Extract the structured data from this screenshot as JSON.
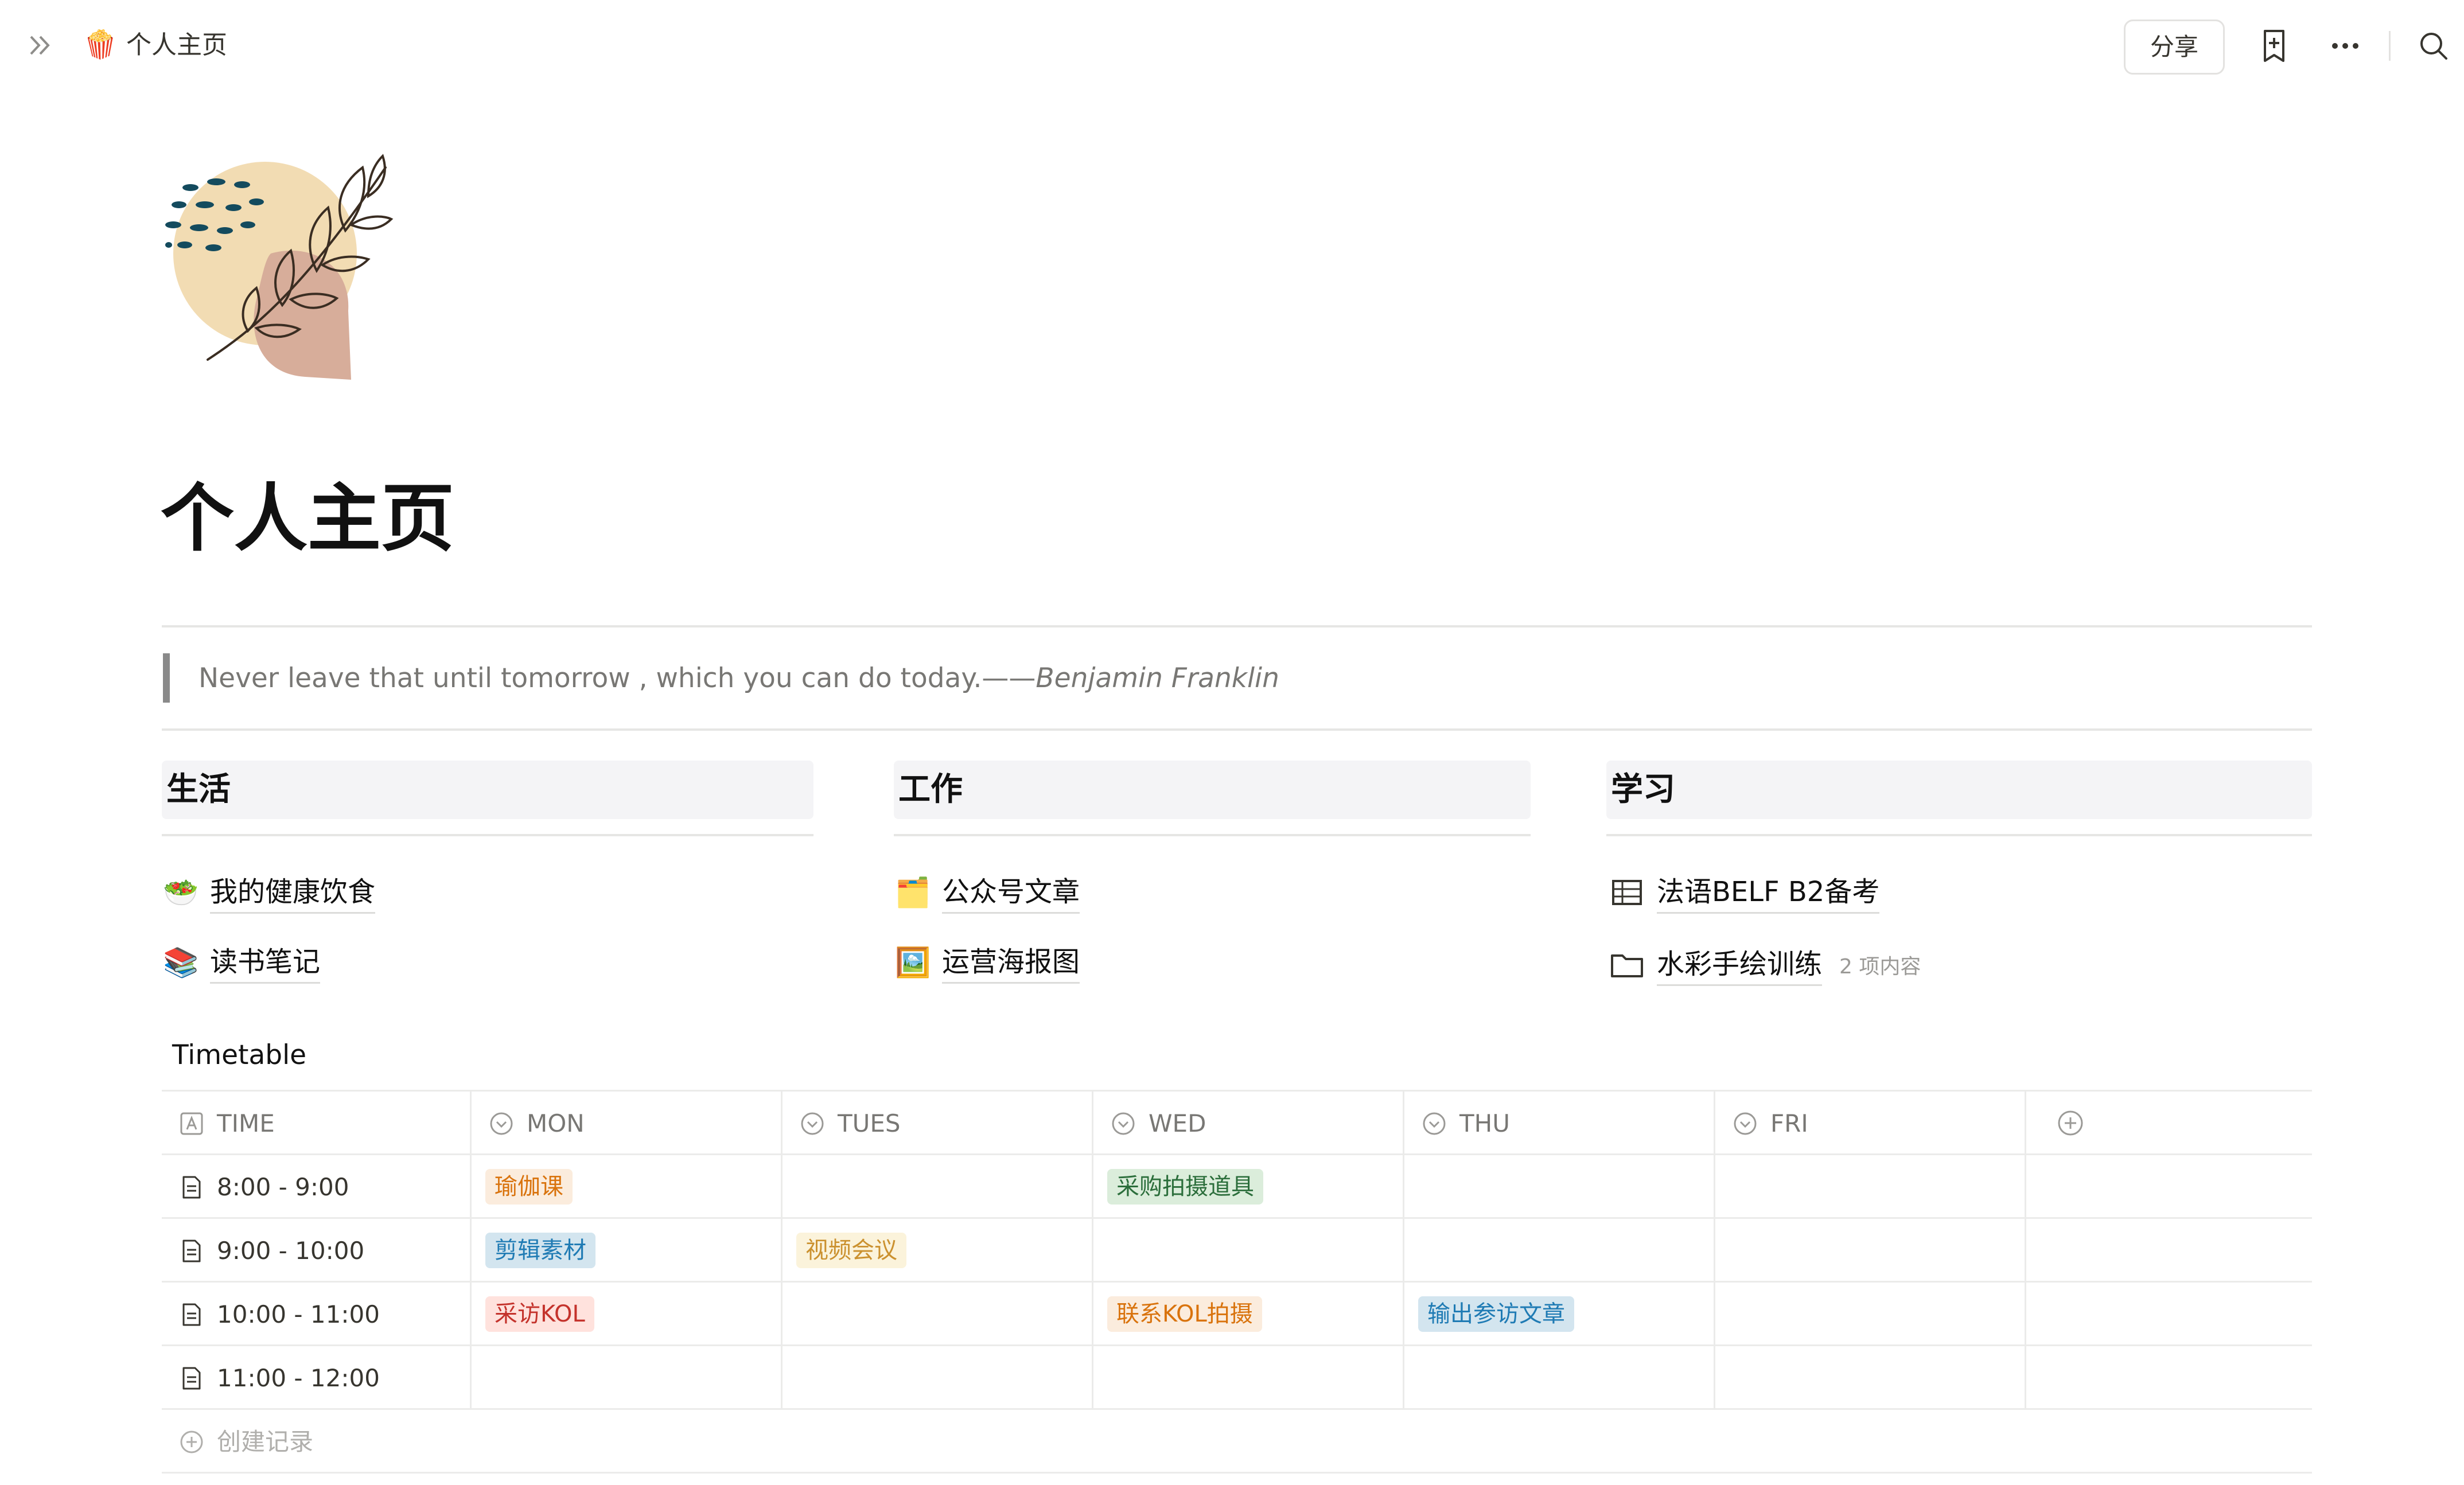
{
  "topbar": {
    "breadcrumb_emoji": "🍿",
    "breadcrumb_title": "个人主页",
    "share_label": "分享",
    "icons": [
      "sidebar-expand-icon",
      "add-page-icon",
      "more-icon",
      "search-icon"
    ]
  },
  "page": {
    "title": "个人主页",
    "quote_text": "Never leave that until tomorrow , which you can do today.——",
    "quote_author": "Benjamin Franklin"
  },
  "columns": [
    {
      "heading": "生活",
      "items": [
        {
          "emoji": "🥗",
          "label": "我的健康饮食"
        },
        {
          "emoji": "📚",
          "label": "读书笔记"
        }
      ]
    },
    {
      "heading": "工作",
      "items": [
        {
          "emoji": "🗂️",
          "label": "公众号文章"
        },
        {
          "emoji": "🖼️",
          "label": "运营海报图"
        }
      ]
    },
    {
      "heading": "学习",
      "items": [
        {
          "icon": "table-icon",
          "label": "法语BELF B2备考"
        },
        {
          "icon": "folder-icon",
          "label": "水彩手绘训练",
          "count": "2 项内容"
        }
      ]
    }
  ],
  "timetable": {
    "title": "Timetable",
    "headers": [
      "TIME",
      "MON",
      "TUES",
      "WED",
      "THU",
      "FRI"
    ],
    "rows": [
      {
        "time": "8:00 - 9:00",
        "mon": "瑜伽课",
        "tues": "",
        "wed": "采购拍摄道具",
        "thu": "",
        "fri": ""
      },
      {
        "time": "9:00 - 10:00",
        "mon": "剪辑素材",
        "tues": "视频会议",
        "wed": "",
        "thu": "",
        "fri": ""
      },
      {
        "time": "10:00 - 11:00",
        "mon": "采访KOL",
        "tues": "",
        "wed": "联系KOL拍摄",
        "thu": "输出参访文章",
        "fri": ""
      },
      {
        "time": "11:00 - 12:00",
        "mon": "",
        "tues": "",
        "wed": "",
        "thu": "",
        "fri": ""
      }
    ],
    "new_row_label": "创建记录"
  },
  "tag_colors": {
    "orange": {
      "bg": "#fbecdd",
      "fg": "#d9730d"
    },
    "green": {
      "bg": "#dbeddb",
      "fg": "#2b6e3b"
    },
    "blue": {
      "bg": "#d3e5ef",
      "fg": "#1f7bb4"
    },
    "yellow": {
      "bg": "#fbf3db",
      "fg": "#cb912f"
    },
    "red": {
      "bg": "#ffe2dd",
      "fg": "#c4332c"
    }
  }
}
